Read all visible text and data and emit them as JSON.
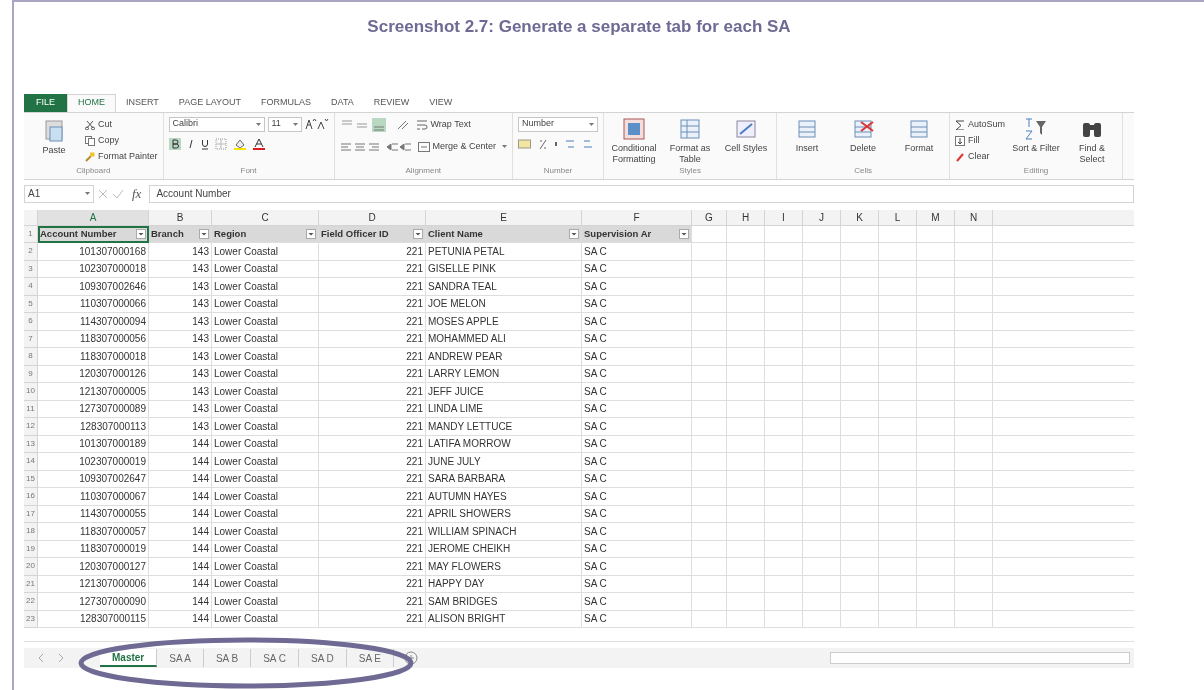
{
  "figure": {
    "title": "Screenshot 2.7: Generate a separate tab for each SA"
  },
  "ribbon_tabs": [
    {
      "label": "FILE",
      "kind": "file",
      "selected": false
    },
    {
      "label": "HOME",
      "kind": "tab",
      "selected": true
    },
    {
      "label": "INSERT",
      "kind": "tab",
      "selected": false
    },
    {
      "label": "PAGE LAYOUT",
      "kind": "tab",
      "selected": false
    },
    {
      "label": "FORMULAS",
      "kind": "tab",
      "selected": false
    },
    {
      "label": "DATA",
      "kind": "tab",
      "selected": false
    },
    {
      "label": "REVIEW",
      "kind": "tab",
      "selected": false
    },
    {
      "label": "VIEW",
      "kind": "tab",
      "selected": false
    }
  ],
  "ribbon_groups": [
    {
      "kind": "clipboard",
      "label": "Clipboard",
      "paste": "Paste",
      "cut": "Cut",
      "copy": "Copy",
      "format_painter": "Format Painter"
    },
    {
      "kind": "font",
      "label": "Font",
      "font_name": "Calibri",
      "font_size": "11"
    },
    {
      "kind": "alignment",
      "label": "Alignment",
      "wrap": "Wrap Text",
      "merge": "Merge & Center"
    },
    {
      "kind": "number",
      "label": "Number",
      "format": "Number"
    },
    {
      "kind": "large_buttons",
      "label": "Styles",
      "buttons": [
        "Conditional Formatting",
        "Format as Table",
        "Cell Styles"
      ]
    },
    {
      "kind": "large_buttons",
      "label": "Cells",
      "buttons": [
        "Insert",
        "Delete",
        "Format"
      ]
    },
    {
      "kind": "editing",
      "label": "Editing",
      "small": [
        "AutoSum",
        "Fill",
        "Clear"
      ],
      "large": [
        "Sort & Filter",
        "Find & Select"
      ]
    }
  ],
  "formula_bar": {
    "name_box": "A1",
    "fx": "fx",
    "value": "Account Number"
  },
  "column_letters": [
    "A",
    "B",
    "C",
    "D",
    "E",
    "F",
    "G",
    "H",
    "I",
    "J",
    "K",
    "L",
    "M",
    "N"
  ],
  "table": {
    "header_row": "1",
    "headers": [
      "Account Number",
      "Branch",
      "Region",
      "Field Officer ID",
      "Client Name",
      "Supervision Ar"
    ],
    "rows": [
      {
        "row": "2",
        "cells": [
          "101307000168",
          "143",
          "Lower Coastal",
          "221",
          "PETUNIA PETAL",
          "SA C"
        ]
      },
      {
        "row": "3",
        "cells": [
          "102307000018",
          "143",
          "Lower Coastal",
          "221",
          "GISELLE PINK",
          "SA C"
        ]
      },
      {
        "row": "4",
        "cells": [
          "109307002646",
          "143",
          "Lower Coastal",
          "221",
          "SANDRA TEAL",
          "SA C"
        ]
      },
      {
        "row": "5",
        "cells": [
          "110307000066",
          "143",
          "Lower Coastal",
          "221",
          "JOE MELON",
          "SA C"
        ]
      },
      {
        "row": "6",
        "cells": [
          "114307000094",
          "143",
          "Lower Coastal",
          "221",
          "MOSES APPLE",
          "SA C"
        ]
      },
      {
        "row": "7",
        "cells": [
          "118307000056",
          "143",
          "Lower Coastal",
          "221",
          "MOHAMMED ALI",
          "SA C"
        ]
      },
      {
        "row": "8",
        "cells": [
          "118307000018",
          "143",
          "Lower Coastal",
          "221",
          "ANDREW PEAR",
          "SA C"
        ]
      },
      {
        "row": "9",
        "cells": [
          "120307000126",
          "143",
          "Lower Coastal",
          "221",
          "LARRY LEMON",
          "SA C"
        ]
      },
      {
        "row": "10",
        "cells": [
          "121307000005",
          "143",
          "Lower Coastal",
          "221",
          "JEFF JUICE",
          "SA C"
        ]
      },
      {
        "row": "11",
        "cells": [
          "127307000089",
          "143",
          "Lower Coastal",
          "221",
          "LINDA LIME",
          "SA C"
        ]
      },
      {
        "row": "12",
        "cells": [
          "128307000113",
          "143",
          "Lower Coastal",
          "221",
          "MANDY LETTUCE",
          "SA C"
        ]
      },
      {
        "row": "13",
        "cells": [
          "101307000189",
          "144",
          "Lower Coastal",
          "221",
          "LATIFA MORROW",
          "SA C"
        ]
      },
      {
        "row": "14",
        "cells": [
          "102307000019",
          "144",
          "Lower Coastal",
          "221",
          "JUNE JULY",
          "SA C"
        ]
      },
      {
        "row": "15",
        "cells": [
          "109307002647",
          "144",
          "Lower Coastal",
          "221",
          "SARA BARBARA",
          "SA C"
        ]
      },
      {
        "row": "16",
        "cells": [
          "110307000067",
          "144",
          "Lower Coastal",
          "221",
          "AUTUMN HAYES",
          "SA C"
        ]
      },
      {
        "row": "17",
        "cells": [
          "114307000055",
          "144",
          "Lower Coastal",
          "221",
          "APRIL SHOWERS",
          "SA C"
        ]
      },
      {
        "row": "18",
        "cells": [
          "118307000057",
          "144",
          "Lower Coastal",
          "221",
          "WILLIAM SPINACH",
          "SA C"
        ]
      },
      {
        "row": "19",
        "cells": [
          "118307000019",
          "144",
          "Lower Coastal",
          "221",
          "JEROME CHEIKH",
          "SA C"
        ]
      },
      {
        "row": "20",
        "cells": [
          "120307000127",
          "144",
          "Lower Coastal",
          "221",
          "MAY FLOWERS",
          "SA C"
        ]
      },
      {
        "row": "21",
        "cells": [
          "121307000006",
          "144",
          "Lower Coastal",
          "221",
          "HAPPY DAY",
          "SA C"
        ]
      },
      {
        "row": "22",
        "cells": [
          "127307000090",
          "144",
          "Lower Coastal",
          "221",
          "SAM BRIDGES",
          "SA C"
        ]
      },
      {
        "row": "23",
        "cells": [
          "128307000115",
          "144",
          "Lower Coastal",
          "221",
          "ALISON BRIGHT",
          "SA C"
        ]
      }
    ]
  },
  "sheet_tabs": [
    {
      "label": "Master",
      "selected": true
    },
    {
      "label": "SA A",
      "selected": false
    },
    {
      "label": "SA B",
      "selected": false
    },
    {
      "label": "SA C",
      "selected": false
    },
    {
      "label": "SA D",
      "selected": false
    },
    {
      "label": "SA E",
      "selected": false
    }
  ]
}
